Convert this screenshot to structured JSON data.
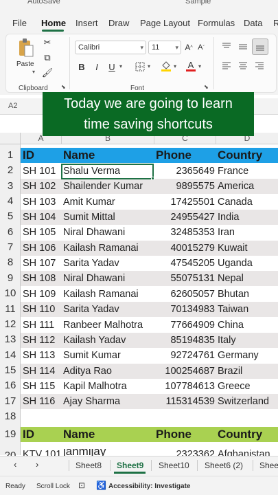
{
  "titlebar": {
    "autosave_label": "AutoSave",
    "doc_title": "Sample"
  },
  "ribbon_tabs": [
    "File",
    "Home",
    "Insert",
    "Draw",
    "Page Layout",
    "Formulas",
    "Data",
    "R"
  ],
  "ribbon": {
    "paste_label": "Paste",
    "clipboard_label": "Clipboard",
    "font_label": "Font",
    "font_name": "Calibri",
    "font_size": "11"
  },
  "name_box": "A2",
  "overlay": {
    "line1": "Today we are going to learn",
    "line2": "time saving shortcuts"
  },
  "columns": [
    "A",
    "B",
    "C",
    "D"
  ],
  "row_numbers": [
    "1",
    "2",
    "3",
    "4",
    "5",
    "6",
    "7",
    "8",
    "9",
    "10",
    "11",
    "12",
    "13",
    "14",
    "15",
    "16",
    "17",
    "18",
    "19",
    "20"
  ],
  "header": {
    "id": "ID",
    "name": "Name",
    "phone": "Phone",
    "country": "Country"
  },
  "rows": [
    {
      "id": "SH 101",
      "name": "Shalu Verma",
      "phone": "2365649",
      "country": "France"
    },
    {
      "id": "SH 102",
      "name": "Shailender Kumar",
      "phone": "9895575",
      "country": "America"
    },
    {
      "id": "SH 103",
      "name": "Amit Kumar",
      "phone": "17425501",
      "country": "Canada"
    },
    {
      "id": "SH 104",
      "name": "Sumit Mittal",
      "phone": "24955427",
      "country": "India"
    },
    {
      "id": "SH 105",
      "name": "Niral Dhawani",
      "phone": "32485353",
      "country": "Iran"
    },
    {
      "id": "SH 106",
      "name": "Kailash Ramanai",
      "phone": "40015279",
      "country": "Kuwait"
    },
    {
      "id": "SH 107",
      "name": "Sarita Yadav",
      "phone": "47545205",
      "country": "Uganda"
    },
    {
      "id": "SH 108",
      "name": "Niral Dhawani",
      "phone": "55075131",
      "country": "Nepal"
    },
    {
      "id": "SH 109",
      "name": "Kailash Ramanai",
      "phone": "62605057",
      "country": "Bhutan"
    },
    {
      "id": "SH 110",
      "name": "Sarita Yadav",
      "phone": "70134983",
      "country": "Taiwan"
    },
    {
      "id": "SH 111",
      "name": "Ranbeer Malhotra",
      "phone": "77664909",
      "country": "China"
    },
    {
      "id": "SH 112",
      "name": "Kailash Yadav",
      "phone": "85194835",
      "country": "Italy"
    },
    {
      "id": "SH 113",
      "name": "Sumit Kumar",
      "phone": "92724761",
      "country": "Germany"
    },
    {
      "id": "SH 114",
      "name": "Aditya Rao",
      "phone": "100254687",
      "country": "Brazil"
    },
    {
      "id": "SH 115",
      "name": "Kapil Malhotra",
      "phone": "107784613",
      "country": "Greece"
    },
    {
      "id": "SH 116",
      "name": "Ajay Sharma",
      "phone": "115314539",
      "country": "Switzerland"
    }
  ],
  "second_header": {
    "id": "ID",
    "name": "Name",
    "phone": "Phone",
    "country": "Country"
  },
  "partial_row": {
    "id": "KTV 101",
    "name": "janmijay",
    "phone": "2323362",
    "country": "Afghanistan"
  },
  "sheet_tabs": [
    "Sheet8",
    "Sheet9",
    "Sheet10",
    "Sheet6 (2)",
    "Shee"
  ],
  "active_sheet": "Sheet9",
  "status": {
    "ready": "Ready",
    "scroll_lock": "Scroll Lock",
    "accessibility": "Accessibility: Investigate"
  },
  "colors": {
    "accent": "#1e7145",
    "header_blue": "#1ea0e6",
    "header_green": "#a9d151",
    "overlay": "#0a6a24",
    "zebra": "#e9e6e6"
  }
}
